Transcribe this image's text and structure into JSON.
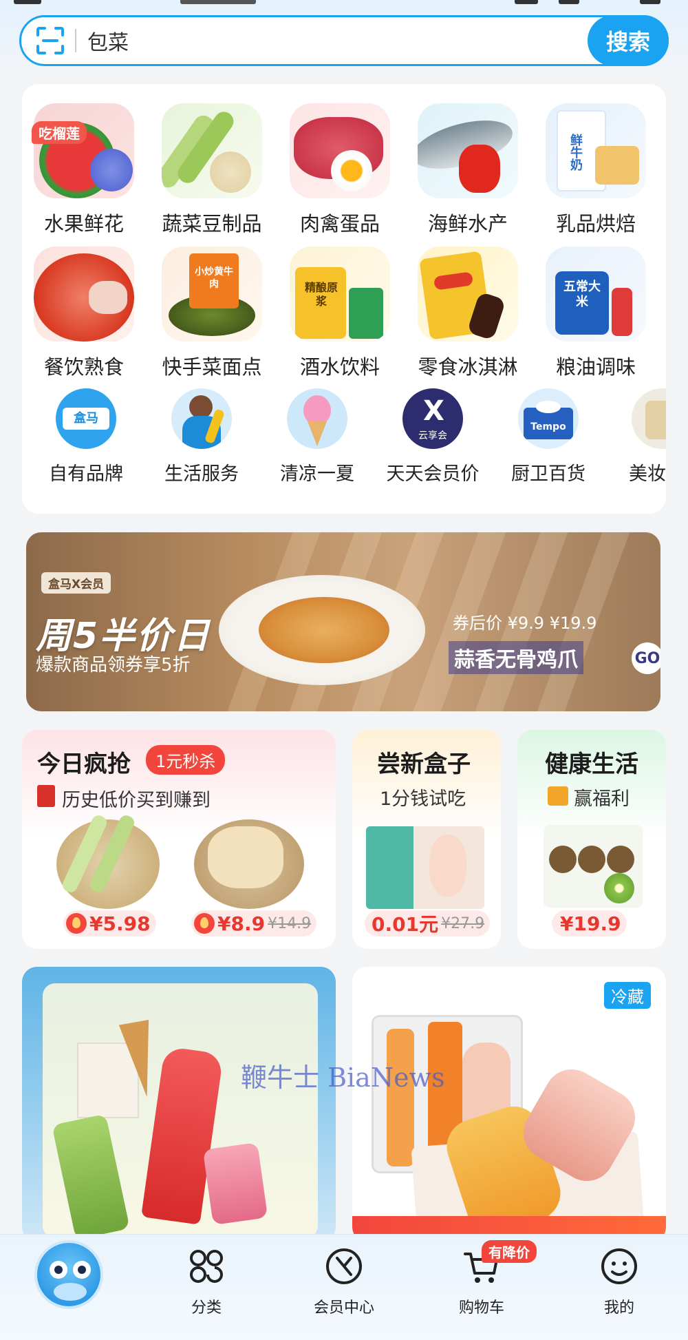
{
  "search": {
    "value": "包菜",
    "button_label": "搜索"
  },
  "categories": {
    "row1": [
      {
        "label": "水果鲜花",
        "badge": "吃榴莲",
        "icon": "watermelon-flower-icon"
      },
      {
        "label": "蔬菜豆制品",
        "icon": "vegetable-icon"
      },
      {
        "label": "肉禽蛋品",
        "icon": "meat-egg-icon"
      },
      {
        "label": "海鲜水产",
        "icon": "seafood-icon"
      },
      {
        "label": "乳品烘焙",
        "icon": "milk-bread-icon",
        "printed_text": "鲜牛奶"
      }
    ],
    "row2": [
      {
        "label": "餐饮熟食",
        "icon": "crayfish-icon"
      },
      {
        "label": "快手菜面点",
        "icon": "quick-dish-icon",
        "printed_text": "小炒黄牛肉"
      },
      {
        "label": "酒水饮料",
        "icon": "beverage-icon",
        "printed_text": "精酿原浆"
      },
      {
        "label": "零食冰淇淋",
        "icon": "snack-icecream-icon"
      },
      {
        "label": "粮油调味",
        "icon": "rice-oil-icon",
        "printed_text": "五常大米"
      }
    ],
    "row3": [
      {
        "label": "自有品牌",
        "icon": "hema-brand-icon",
        "printed_text": "盒马"
      },
      {
        "label": "生活服务",
        "icon": "cleaner-service-icon"
      },
      {
        "label": "清凉一夏",
        "icon": "ice-cream-cone-icon"
      },
      {
        "label": "天天会员价",
        "icon": "member-x-icon",
        "printed_text": "云享会"
      },
      {
        "label": "厨卫百货",
        "icon": "tissue-icon",
        "printed_text": "Tempo"
      },
      {
        "label": "美妆",
        "icon": "cosmetics-icon"
      }
    ]
  },
  "banner": {
    "brand": "盒马X会员",
    "title": "周5半价日",
    "subtitle": "爆款商品领券享5折",
    "price_line": "券后价 ¥9.9 ¥19.9",
    "product": "蒜香无骨鸡爪",
    "go_label": "GO"
  },
  "promos": {
    "flash": {
      "title": "今日疯抢",
      "badge": "1元秒杀",
      "subtitle": "历史低价买到赚到",
      "items": [
        {
          "price": "¥5.98",
          "old_price": ""
        },
        {
          "price": "¥8.9",
          "old_price": "¥14.9"
        }
      ]
    },
    "trial": {
      "title": "尝新盒子",
      "subtitle": "1分钱试吃",
      "price": "0.01元",
      "old_price": "¥27.9"
    },
    "health": {
      "title": "健康生活",
      "subtitle": "赢福利",
      "price": "¥19.9"
    }
  },
  "bottom_cards": {
    "right_tag": "冷藏"
  },
  "watermark": "鞭牛士 BiaNews",
  "tabbar": {
    "home_icon": "hippo-mascot-icon",
    "items": [
      {
        "label": "分类",
        "icon": "category-grid-icon"
      },
      {
        "label": "会员中心",
        "icon": "member-center-icon"
      },
      {
        "label": "购物车",
        "icon": "cart-icon",
        "badge": "有降价"
      },
      {
        "label": "我的",
        "icon": "profile-smile-icon"
      }
    ]
  },
  "colors": {
    "accent": "#1aa3f0",
    "price_red": "#e8372e",
    "badge_red": "#f2463d"
  }
}
